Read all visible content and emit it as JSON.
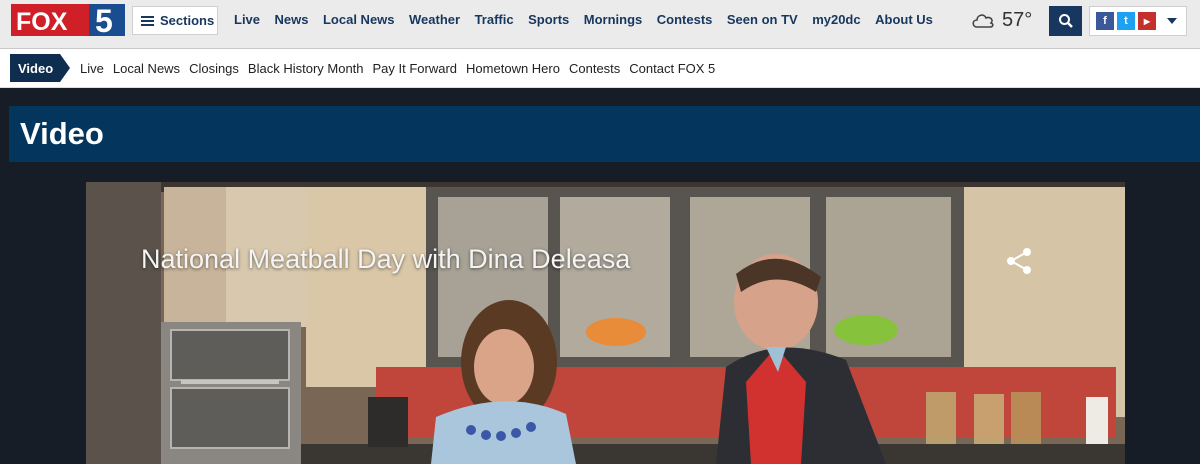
{
  "header": {
    "logo_text": "FOX 5",
    "sections_label": "Sections",
    "nav": [
      "Live",
      "News",
      "Local News",
      "Weather",
      "Traffic",
      "Sports",
      "Mornings",
      "Contests",
      "Seen on TV",
      "my20dc",
      "About Us"
    ],
    "weather": {
      "temp": "57°",
      "icon": "cloud-icon"
    }
  },
  "subnav": {
    "active": "Video",
    "items": [
      "Live",
      "Local News",
      "Closings",
      "Black History Month",
      "Pay It Forward",
      "Hometown Hero",
      "Contests",
      "Contact FOX 5"
    ]
  },
  "page": {
    "title": "Video"
  },
  "video": {
    "title": "National Meatball Day with Dina Deleasa"
  },
  "colors": {
    "brand_navy": "#17375e",
    "title_band": "#04365d",
    "fox_red": "#cf2027",
    "page_bg": "#171d27"
  }
}
